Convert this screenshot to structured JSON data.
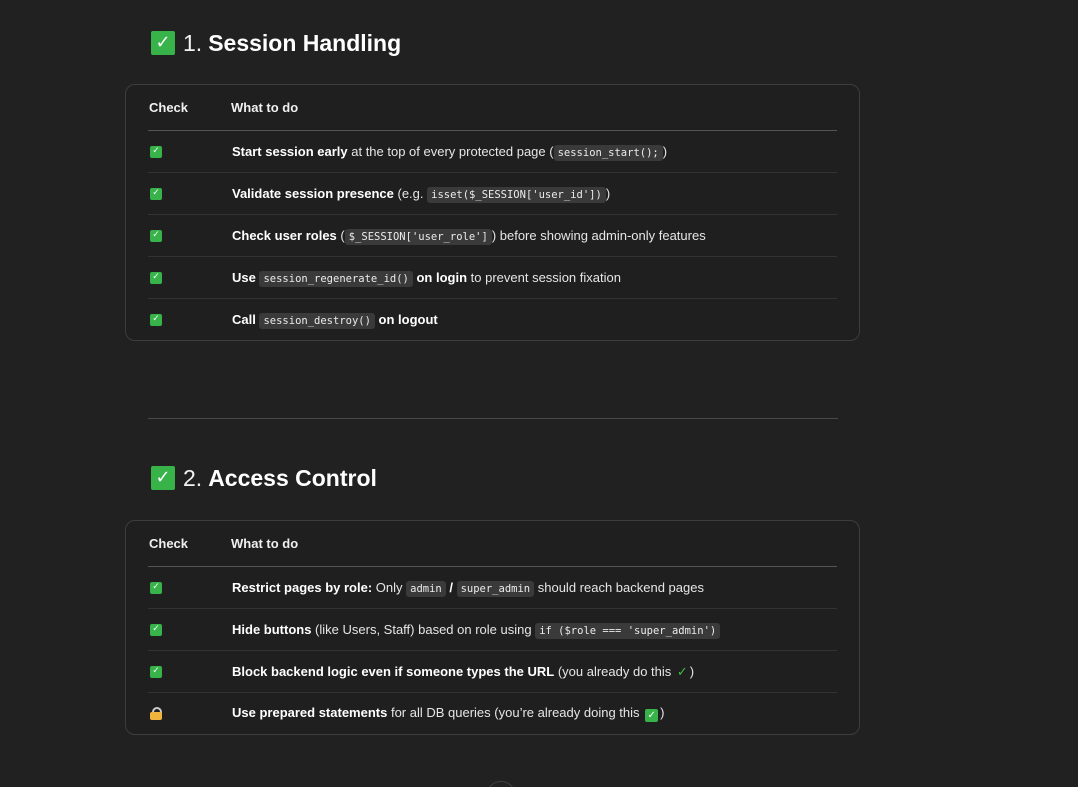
{
  "sections": [
    {
      "number": "1.",
      "title": "Session Handling",
      "headers": {
        "check": "Check",
        "todo": "What to do"
      },
      "rows": [
        {
          "icon": "green-check",
          "bold": "Start session early",
          "t1": " at the top of every protected page (",
          "code": "session_start();",
          "t2": ")"
        },
        {
          "icon": "green-check",
          "bold": "Validate session presence",
          "t1": " (e.g. ",
          "code": "isset($_SESSION['user_id'])",
          "t2": ")"
        },
        {
          "icon": "green-check",
          "bold": "Check user roles",
          "t1": " (",
          "code": "$_SESSION['user_role']",
          "t2": ") before showing admin-only features"
        },
        {
          "icon": "green-check",
          "bold": "Use ",
          "code": "session_regenerate_id()",
          "bold2": " on login",
          "t2": " to prevent session fixation"
        },
        {
          "icon": "green-check",
          "bold": "Call ",
          "code": "session_destroy()",
          "bold2": " on logout"
        }
      ]
    },
    {
      "number": "2.",
      "title": "Access Control",
      "headers": {
        "check": "Check",
        "todo": "What to do"
      },
      "rows": [
        {
          "icon": "green-check",
          "bold": "Restrict pages by role:",
          "t1": " Only ",
          "code": "admin",
          "t2": " / ",
          "code2": "super_admin",
          "t3": " should reach backend pages"
        },
        {
          "icon": "green-check",
          "bold": "Hide buttons",
          "t1": " (like Users, Staff) based on role using ",
          "code": "if ($role === 'super_admin')"
        },
        {
          "icon": "green-check",
          "bold": "Block backend logic even if someone types the URL",
          "t1": " (you already do this ",
          "tick": "✓",
          "t2": ")"
        },
        {
          "icon": "lock",
          "bold": "Use prepared statements",
          "t1": " for all DB queries (you’re already doing this ",
          "t2": ")"
        }
      ]
    }
  ],
  "icons": {
    "title_check": "white-heavy-check-mark",
    "lock": "lock-emoji"
  },
  "colors": {
    "background": "#212121",
    "check_green": "#37b34a",
    "border": "#3d3d3d"
  }
}
